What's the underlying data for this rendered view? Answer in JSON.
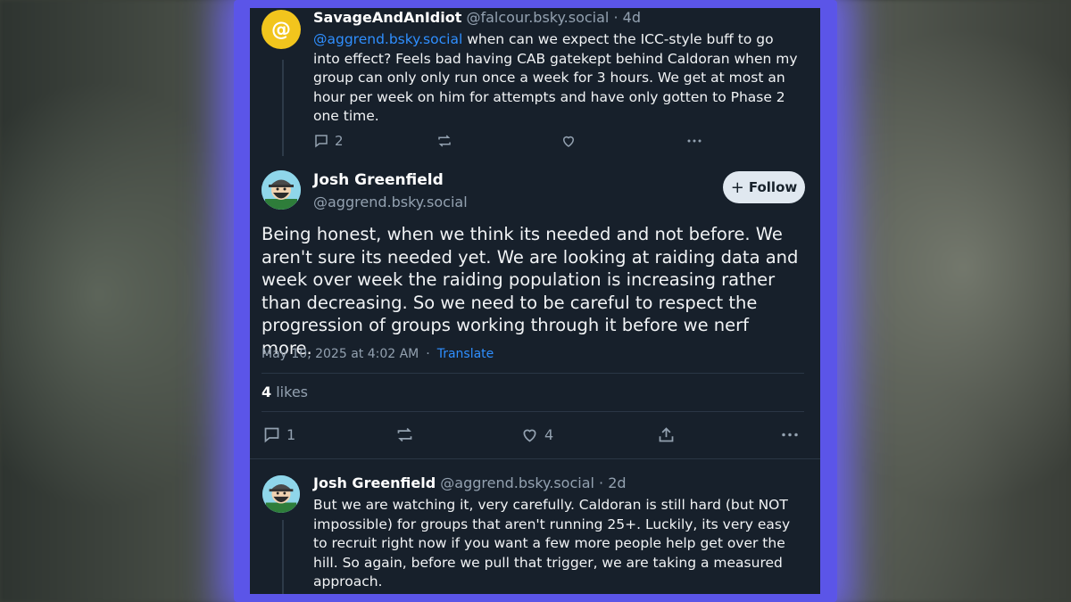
{
  "post1": {
    "author": "SavageAndAnIdiot",
    "handle": "@falcour.bsky.social",
    "age": "· 4d",
    "mention": "@aggrend.bsky.social",
    "text": " when can we expect the ICC-style buff to go into effect? Feels bad having CAB gatekept behind Caldoran when my group can only only run once a week for 3 hours.  We get at most an hour per week on him for attempts and have only gotten to Phase 2 one time.",
    "replies": "2",
    "avatar_icon": "at-sign-icon"
  },
  "main_post": {
    "author": "Josh Greenfield",
    "handle": "@aggrend.bsky.social",
    "follow_label": "Follow",
    "text": "Being honest, when we think its needed and not before. We aren't sure its needed yet. We are looking at raiding data and week over week the raiding population is increasing rather than decreasing. So we need to be careful to respect the progression of groups working through it before we nerf more.",
    "timestamp": "May 10, 2025 at 4:02 AM",
    "separator": "·",
    "translate_label": "Translate",
    "likes_count": "4",
    "likes_label": "likes",
    "replies": "1",
    "like_count": "4"
  },
  "post3": {
    "author": "Josh Greenfield",
    "handle": "@aggrend.bsky.social",
    "age": "· 2d",
    "text": "But we are watching it, very carefully. Caldoran is still  hard (but NOT impossible) for groups that aren't running 25+. Luckily, its very easy to recruit right now if you want a few more people help get over the hill. So again, before we pull that trigger, we are taking a measured approach."
  },
  "colors": {
    "panel_bg": "#17202b",
    "glow": "#5b55e8",
    "link": "#2f8fff",
    "muted": "#93a1b0"
  }
}
